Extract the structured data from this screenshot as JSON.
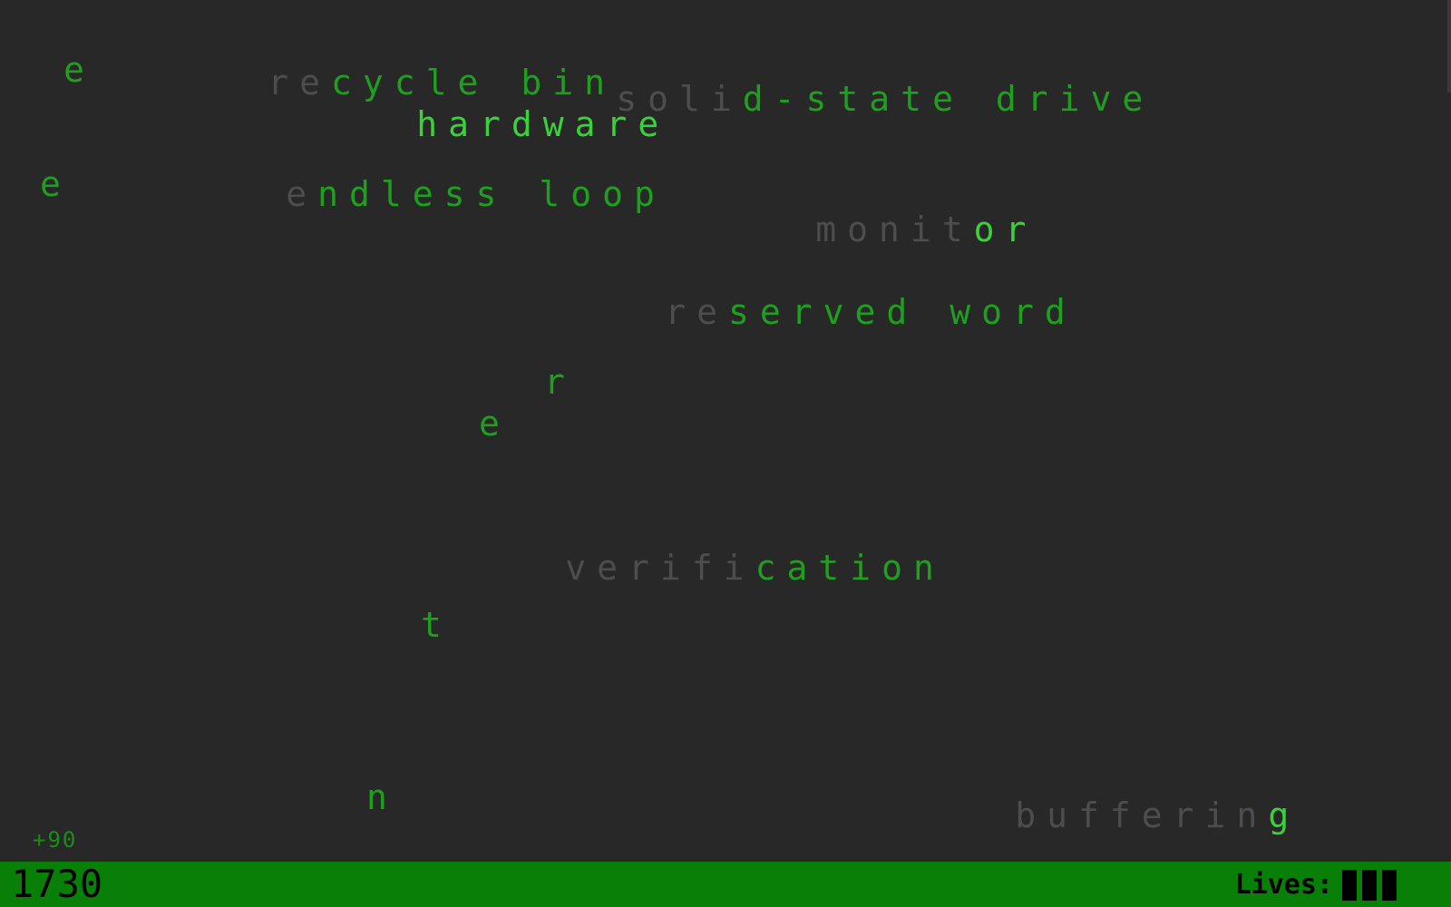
{
  "words": [
    {
      "typed": "re",
      "remaining": "cycle bin"
    },
    {
      "typed": "",
      "remaining": "hardware"
    },
    {
      "typed": "soli",
      "remaining": "d-state drive"
    },
    {
      "typed": "e",
      "remaining": "ndless loop"
    },
    {
      "typed": "monit",
      "remaining": "or"
    },
    {
      "typed": "re",
      "remaining": "served word"
    },
    {
      "typed": "verifi",
      "remaining": "cation"
    },
    {
      "typed": "bufferin",
      "remaining": "g"
    }
  ],
  "stray_letters": [
    "e",
    "e",
    "r",
    "e",
    "t",
    "n"
  ],
  "bonus_popup": "+90",
  "hud": {
    "score": "1730",
    "lives_label": "Lives:",
    "lives": 3
  },
  "colors": {
    "background": "#282828",
    "typed_letters": "#4d4d4d",
    "word_letters": "#1ea01e",
    "hud_bar": "#088008",
    "hud_text": "#000000"
  }
}
